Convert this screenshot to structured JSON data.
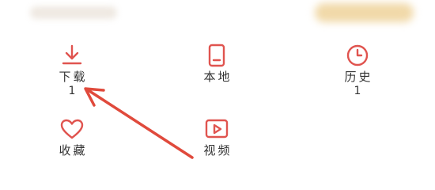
{
  "menu": {
    "download": {
      "label": "下载",
      "count": "1",
      "icon": "download-icon"
    },
    "local": {
      "label": "本地",
      "icon": "phone-icon"
    },
    "history": {
      "label": "历史",
      "count": "1",
      "icon": "clock-icon"
    },
    "favorites": {
      "label": "收藏",
      "icon": "heart-icon"
    },
    "video": {
      "label": "视频",
      "icon": "video-play-icon"
    }
  },
  "accent_color": "#e0544f",
  "annotation_color": "#e04a3c"
}
